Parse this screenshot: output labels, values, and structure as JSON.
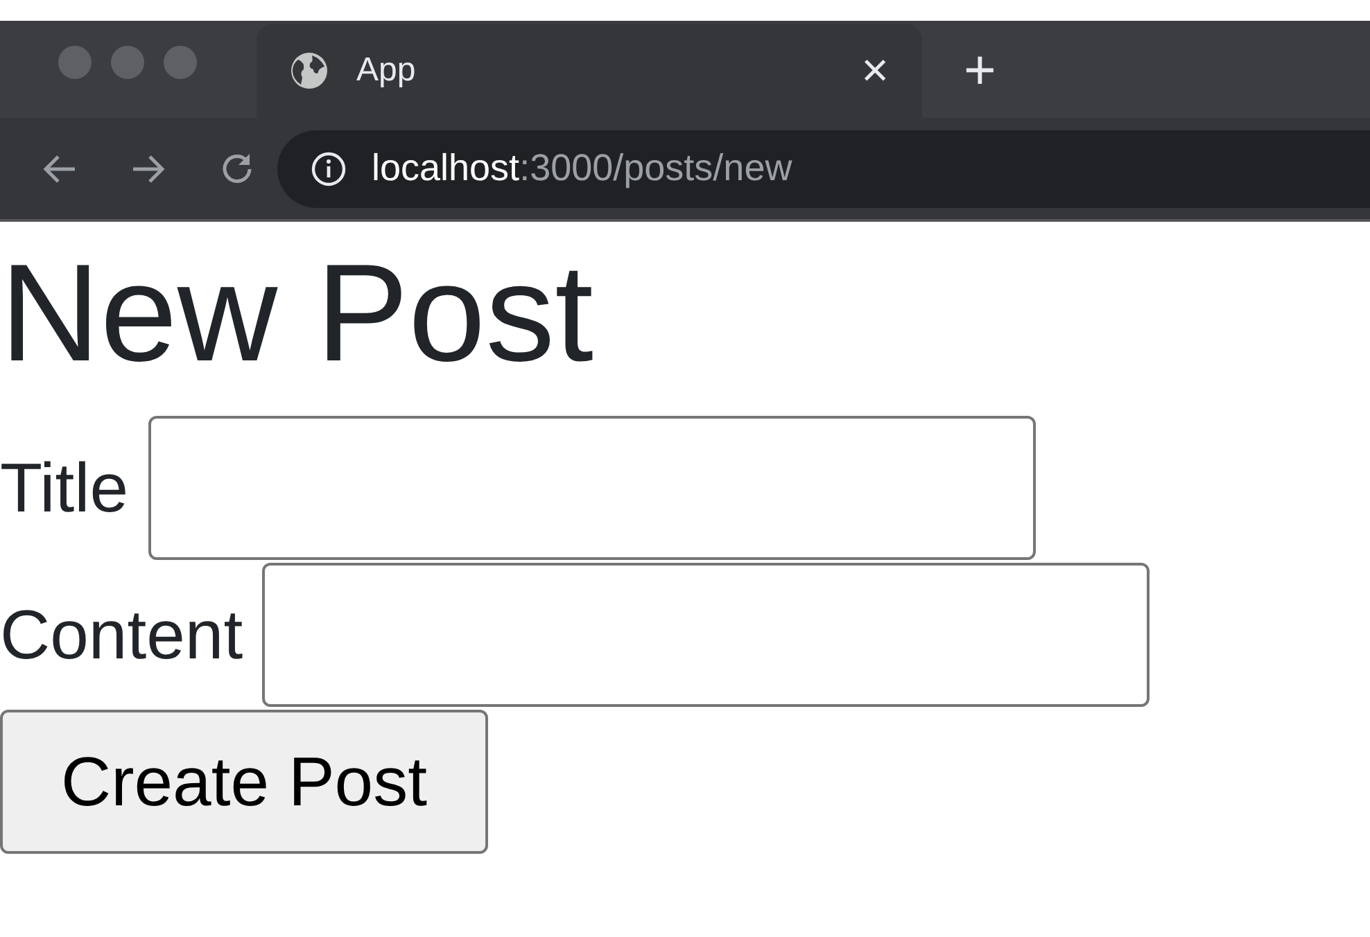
{
  "browser": {
    "tab": {
      "title": "App",
      "close": "×"
    },
    "new_tab": "+",
    "address": {
      "host": "localhost",
      "rest": ":3000/posts/new"
    }
  },
  "heading": "New Post",
  "fields": [
    {
      "label": "Title"
    },
    {
      "label": "Content"
    }
  ],
  "button": "Create Post"
}
